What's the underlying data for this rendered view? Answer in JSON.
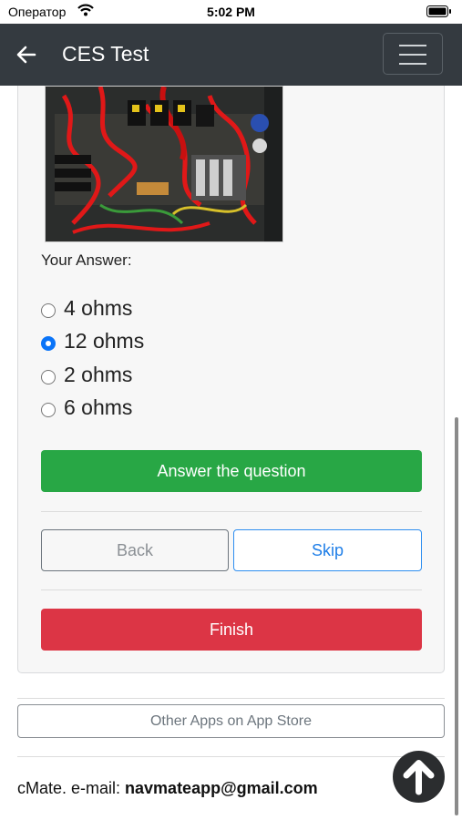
{
  "status_bar": {
    "carrier": "Оператор",
    "time": "5:02 PM"
  },
  "header": {
    "title": "CES Test",
    "back_icon": "arrow-left-icon",
    "menu_icon": "hamburger-menu-icon"
  },
  "question": {
    "image_alt": "electrical panel wiring photo",
    "your_answer_label": "Your Answer:",
    "options": [
      {
        "label": "4 ohms",
        "selected": false
      },
      {
        "label": "12 ohms",
        "selected": true
      },
      {
        "label": "2 ohms",
        "selected": false
      },
      {
        "label": "6 ohms",
        "selected": false
      }
    ]
  },
  "buttons": {
    "answer": "Answer the question",
    "back": "Back",
    "skip": "Skip",
    "finish": "Finish",
    "other_apps": "Other Apps on App Store"
  },
  "footer": {
    "prefix": "cMate. e-mail: ",
    "email": "navmateapp@gmail.com"
  },
  "colors": {
    "success": "#28a745",
    "danger": "#dc3545",
    "primary": "#1e7ee8",
    "navbar": "#343a40"
  }
}
